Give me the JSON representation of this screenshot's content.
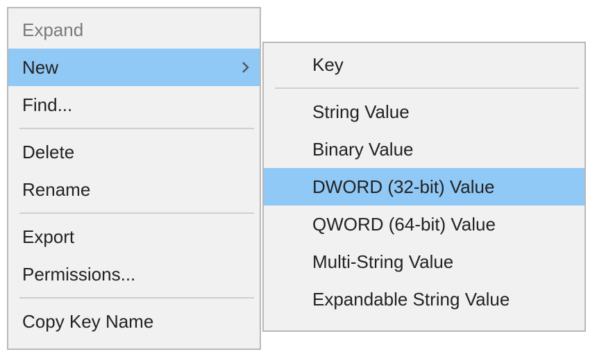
{
  "main_menu": {
    "expand": {
      "label": "Expand"
    },
    "new": {
      "label": "New"
    },
    "find": {
      "label": "Find..."
    },
    "delete": {
      "label": "Delete"
    },
    "rename": {
      "label": "Rename"
    },
    "export": {
      "label": "Export"
    },
    "permissions": {
      "label": "Permissions..."
    },
    "copy_key_name": {
      "label": "Copy Key Name"
    }
  },
  "new_submenu": {
    "key": {
      "label": "Key"
    },
    "string": {
      "label": "String Value"
    },
    "binary": {
      "label": "Binary Value"
    },
    "dword": {
      "label": "DWORD (32-bit) Value"
    },
    "qword": {
      "label": "QWORD (64-bit) Value"
    },
    "multi_string": {
      "label": "Multi-String Value"
    },
    "expandable_string": {
      "label": "Expandable String Value"
    }
  },
  "colors": {
    "menu_bg": "#f1f1f1",
    "highlight": "#90c8f6",
    "border": "#b8b8b8",
    "separator": "#cfcfcf",
    "disabled_text": "#7a7a7a"
  }
}
